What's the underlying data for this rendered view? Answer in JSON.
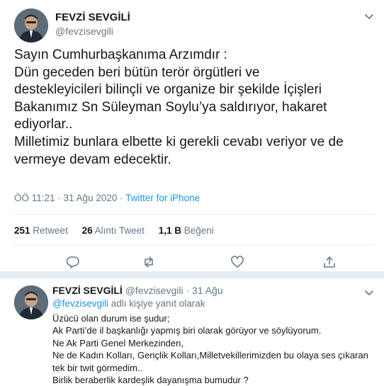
{
  "tweet": {
    "author_name": "FEVZİ SEVGİLİ",
    "author_handle": "@fevzisevgili",
    "lines": [
      "Sayın Cumhurbaşkanıma Arzımdır :",
      "Dün geceden beri bütün terör örgütleri ve",
      "destekleyicileri bilinçli ve organize bir şekilde İçişleri",
      "Bakanımız Sn Süleyman Soylu’ya saldırıyor, hakaret",
      "ediyorlar..",
      "Milletimiz bunlara elbette ki gerekli cevabı veriyor ve de",
      "vermeye devam edecektir."
    ],
    "timestamp": "ÖÖ 11:21 · 31 Ağu 2020 · ",
    "source": "Twitter for iPhone",
    "stats": {
      "retweets_count": "251",
      "retweets_label": "Retweet",
      "quotes_count": "26",
      "quotes_label": "Alıntı Tweet",
      "likes_count": "1,1 B",
      "likes_label": "Beğeni"
    },
    "icons": [
      "chevron-down-icon",
      "reply-icon",
      "retweet-icon",
      "like-icon",
      "share-icon"
    ]
  },
  "reply": {
    "author_name": "FEVZİ SEVGİLİ",
    "author_handle_date": "@fevzisevgili · 31 Ağu",
    "replying_mention": "@fevzisevgili",
    "replying_suffix": " adlı kişiye yanıt olarak",
    "lines": [
      "Üzücü olan durum ise şudur;",
      "Ak Parti’de il başkanlığı yapmış biri olarak görüyor ve söylüyorum.",
      "Ne Ak Parti Genel Merkezinden,",
      "Ne de Kadın Kolları, Gençlik Kolları,Milletvekillerimizden bu olaya ses çıkaran",
      "tek bir twit görmedim..",
      "Birlik beraberlik kardeşlik dayanışma bumudur ?"
    ]
  },
  "colors": {
    "text": "#14171a",
    "secondary": "#657786",
    "link": "#1b95e0",
    "divider": "#e6ecf0"
  }
}
